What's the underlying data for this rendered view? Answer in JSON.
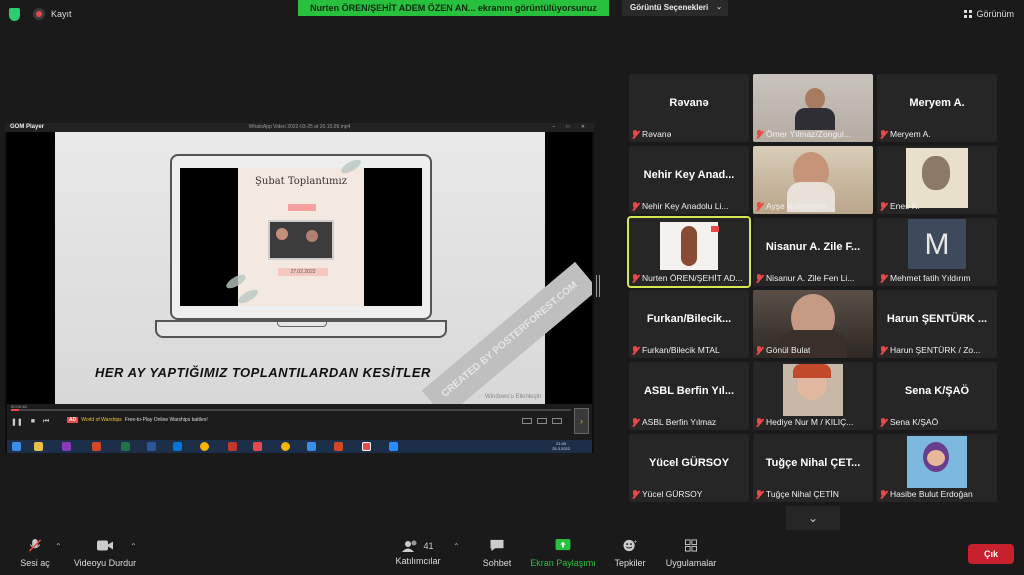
{
  "topbar": {
    "record_label": "Kayıt",
    "share_banner": "Nurten ÖREN/ŞEHİT ADEM ÖZEN AN... ekranını görüntülüyorsunuz",
    "view_options": "Görüntü Seçenekleri",
    "view_label": "Görünüm"
  },
  "shared_screen": {
    "player_name": "GOM Player",
    "file_name": "WhatsApp Video 2022-03-25 at 20.15.09.mp4",
    "poster_title": "Şubat Toplantımız",
    "poster_date": "27.02.2022",
    "caption": "HER AY YAPTIĞIMIZ TOPLANTILARDAN KESİTLER",
    "watermark": "CREATED BY POSTERFOREST.COM",
    "windows_activation": "Windows'u Etkinleştir",
    "time": "00:00:48",
    "ad_badge": "AD",
    "ad_game": "World of Warships",
    "ad_text": "Free-to-Play Online Warships battles!",
    "clock_time": "21:00",
    "clock_date": "25.3.2022"
  },
  "participants": [
    {
      "name": "Rəvanə",
      "label": "Rəvanə",
      "type": "name"
    },
    {
      "name": "Ömer Yılmaz/Zongul...",
      "label": "Ömer Yılmaz/Zongul...",
      "type": "video"
    },
    {
      "name": "Meryem A.",
      "label": "Meryem A.",
      "type": "name"
    },
    {
      "name": "Nehir Key Anad...",
      "label": "Nehir Key Anadolu Li...",
      "type": "name"
    },
    {
      "name": "Ayşe Kahraman",
      "label": "Ayşe Kahraman",
      "type": "video"
    },
    {
      "name": "Enes K.",
      "label": "Enes K.",
      "type": "image"
    },
    {
      "name": "Nurten ÖREN/ŞEHİT AD...",
      "label": "Nurten ÖREN/ŞEHİT AD...",
      "type": "image"
    },
    {
      "name": "Nisanur A. Zile F...",
      "label": "Nisanur A. Zile Fen Li...",
      "type": "name"
    },
    {
      "name": "M",
      "label": "Mehmet fatih Yıldırım",
      "type": "avatar"
    },
    {
      "name": "Furkan/Bilecik...",
      "label": "Furkan/Bilecik MTAL",
      "type": "name"
    },
    {
      "name": "Gönül Bulat",
      "label": "Gönül Bulat",
      "type": "video"
    },
    {
      "name": "Harun ŞENTÜRK ...",
      "label": "Harun ŞENTÜRK / Zo...",
      "type": "name"
    },
    {
      "name": "ASBL Berfin Yıl...",
      "label": "ASBL Berfin Yılmaz",
      "type": "name"
    },
    {
      "name": "Hediye Nur M / KILIÇ...",
      "label": "Hediye Nur M / KILIÇ...",
      "type": "video"
    },
    {
      "name": "Sena K/ŞAÖ",
      "label": "Sena K/ŞAÖ",
      "type": "name"
    },
    {
      "name": "Yücel GÜRSOY",
      "label": "Yücel GÜRSOY",
      "type": "name"
    },
    {
      "name": "Tuğçe Nihal ÇET...",
      "label": "Tuğçe Nihal ÇETİN",
      "type": "name"
    },
    {
      "name": "Hasibe Bulut Erdoğan",
      "label": "Hasibe Bulut Erdoğan",
      "type": "image"
    }
  ],
  "toolbar": {
    "mute": "Sesi aç",
    "video": "Videoyu Durdur",
    "participants": "Katılımcılar",
    "participants_count": "41",
    "chat": "Sohbet",
    "share": "Ekran Paylaşımı",
    "reactions": "Tepkiler",
    "apps": "Uygulamalar",
    "leave": "Çık"
  },
  "colors": {
    "banner_green": "#27c13d",
    "active_speaker": "#d6e655",
    "leave_red": "#c8202d",
    "mute_red": "#e84a4a"
  }
}
